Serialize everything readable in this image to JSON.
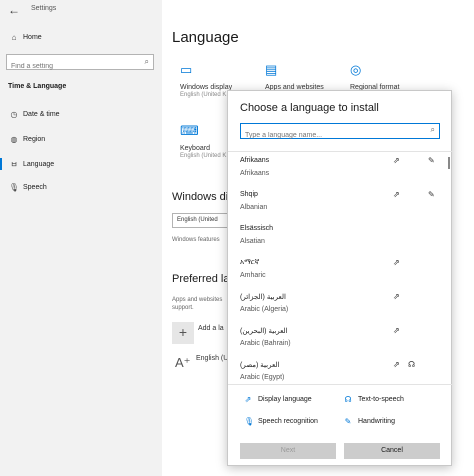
{
  "window": {
    "title": "Settings",
    "back_glyph": "←"
  },
  "sidebar": {
    "home": "Home",
    "search_placeholder": "Find a setting",
    "section": "Time & Language",
    "items": [
      {
        "label": "Date & time",
        "icon": "clock-icon"
      },
      {
        "label": "Region",
        "icon": "globe-icon"
      },
      {
        "label": "Language",
        "icon": "language-icon"
      },
      {
        "label": "Speech",
        "icon": "microphone-icon"
      }
    ]
  },
  "main": {
    "title": "Language",
    "tiles": [
      {
        "label": "Windows display",
        "sub": "English (United K"
      },
      {
        "label": "Apps and websites",
        "sub": ""
      },
      {
        "label": "Regional format",
        "sub": ""
      },
      {
        "label": "Keyboard",
        "sub": "English (United K"
      }
    ],
    "windows_display_heading": "Windows di",
    "dropdown_value": "English (United",
    "features_text": "Windows features",
    "preferred_heading": "Preferred la",
    "preferred_text_1": "Apps and websites",
    "preferred_text_2": "support.",
    "add_language": "Add a la",
    "english_entry": "English (U"
  },
  "dialog": {
    "title": "Choose a language to install",
    "search_placeholder": "Type a language name...",
    "languages": [
      {
        "name": "Afrikaans",
        "sub": "Afrikaans"
      },
      {
        "name": "Shqip",
        "sub": "Albanian"
      },
      {
        "name": "Elsässisch",
        "sub": "Alsatian"
      },
      {
        "name": "አማርኛ",
        "sub": "Amharic"
      },
      {
        "name": "العربية (الجزائر)",
        "sub": "Arabic (Algeria)"
      },
      {
        "name": "العربية (البحرين)",
        "sub": "Arabic (Bahrain)"
      },
      {
        "name": "العربية (مصر)",
        "sub": "Arabic (Egypt)"
      }
    ],
    "legend": {
      "display_language": "Display language",
      "text_to_speech": "Text-to-speech",
      "speech_recognition": "Speech recognition",
      "handwriting": "Handwriting"
    },
    "next_label": "Next",
    "cancel_label": "Cancel"
  },
  "colors": {
    "accent": "#0078d7",
    "sidebar_bg": "#f2f2f2",
    "button_bg": "#cccccc"
  }
}
